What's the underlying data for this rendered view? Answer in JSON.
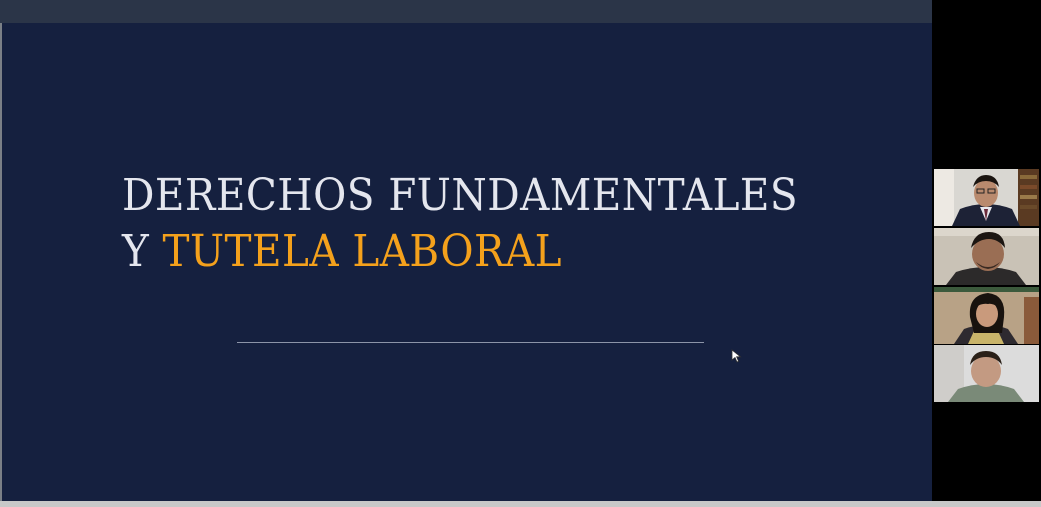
{
  "slide": {
    "title_line1": "DERECHOS FUNDAMENTALES",
    "title_line2_prefix": "Y ",
    "title_line2_accent": "TUTELA LABORAL"
  },
  "colors": {
    "slide_background": "#15203f",
    "title_text": "#e4e6ee",
    "accent": "#f4a11c",
    "topbar": "#2b3548"
  },
  "participants": [
    {
      "video": "participant-1-video"
    },
    {
      "video": "participant-2-video"
    },
    {
      "video": "participant-3-video"
    },
    {
      "video": "participant-4-video"
    }
  ]
}
